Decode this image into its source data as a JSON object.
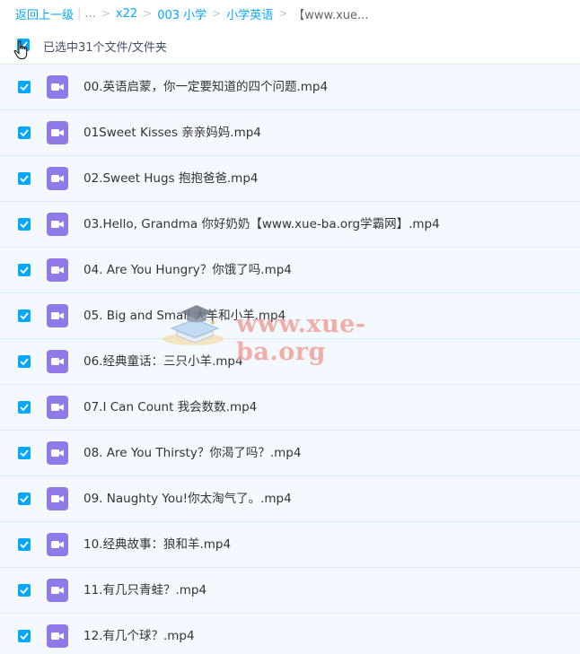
{
  "breadcrumb": {
    "back_label": "返回上一级",
    "ellipsis": "...",
    "items": [
      "x22",
      "003 小学",
      "小学英语"
    ],
    "current": "【www.xue..."
  },
  "selection": {
    "status_text": "已选中31个文件/文件夹",
    "checked": true
  },
  "files": [
    {
      "name": "00.英语启蒙，你一定要知道的四个问题.mp4",
      "checked": true
    },
    {
      "name": "01Sweet Kisses 亲亲妈妈.mp4",
      "checked": true
    },
    {
      "name": "02.Sweet Hugs 抱抱爸爸.mp4",
      "checked": true
    },
    {
      "name": "03.Hello, Grandma 你好奶奶【www.xue-ba.org学霸网】.mp4",
      "checked": true
    },
    {
      "name": "04. Are You Hungry？你饿了吗.mp4",
      "checked": true
    },
    {
      "name": "05. Big and Small 大羊和小羊.mp4",
      "checked": true
    },
    {
      "name": "06.经典童话：三只小羊.mp4",
      "checked": true
    },
    {
      "name": "07.I Can Count 我会数数.mp4",
      "checked": true
    },
    {
      "name": "08. Are You Thirsty？你渴了吗？.mp4",
      "checked": true
    },
    {
      "name": "09. Naughty You!你太淘气了。.mp4",
      "checked": true
    },
    {
      "name": "10.经典故事：狼和羊.mp4",
      "checked": true
    },
    {
      "name": "11.有几只青蛙？.mp4",
      "checked": true
    },
    {
      "name": "12.有几个球？.mp4",
      "checked": true
    }
  ],
  "watermark": {
    "text": "www.xue-ba.org"
  },
  "colors": {
    "accent": "#06a7ff",
    "row_bg": "#f4f9ff",
    "video_icon": "#8f7ae8",
    "watermark": "#f0a19a"
  },
  "icons": {
    "file_type": "video-file-icon",
    "checkbox": "checkbox-checked-icon",
    "cursor": "hand-cursor-icon"
  }
}
